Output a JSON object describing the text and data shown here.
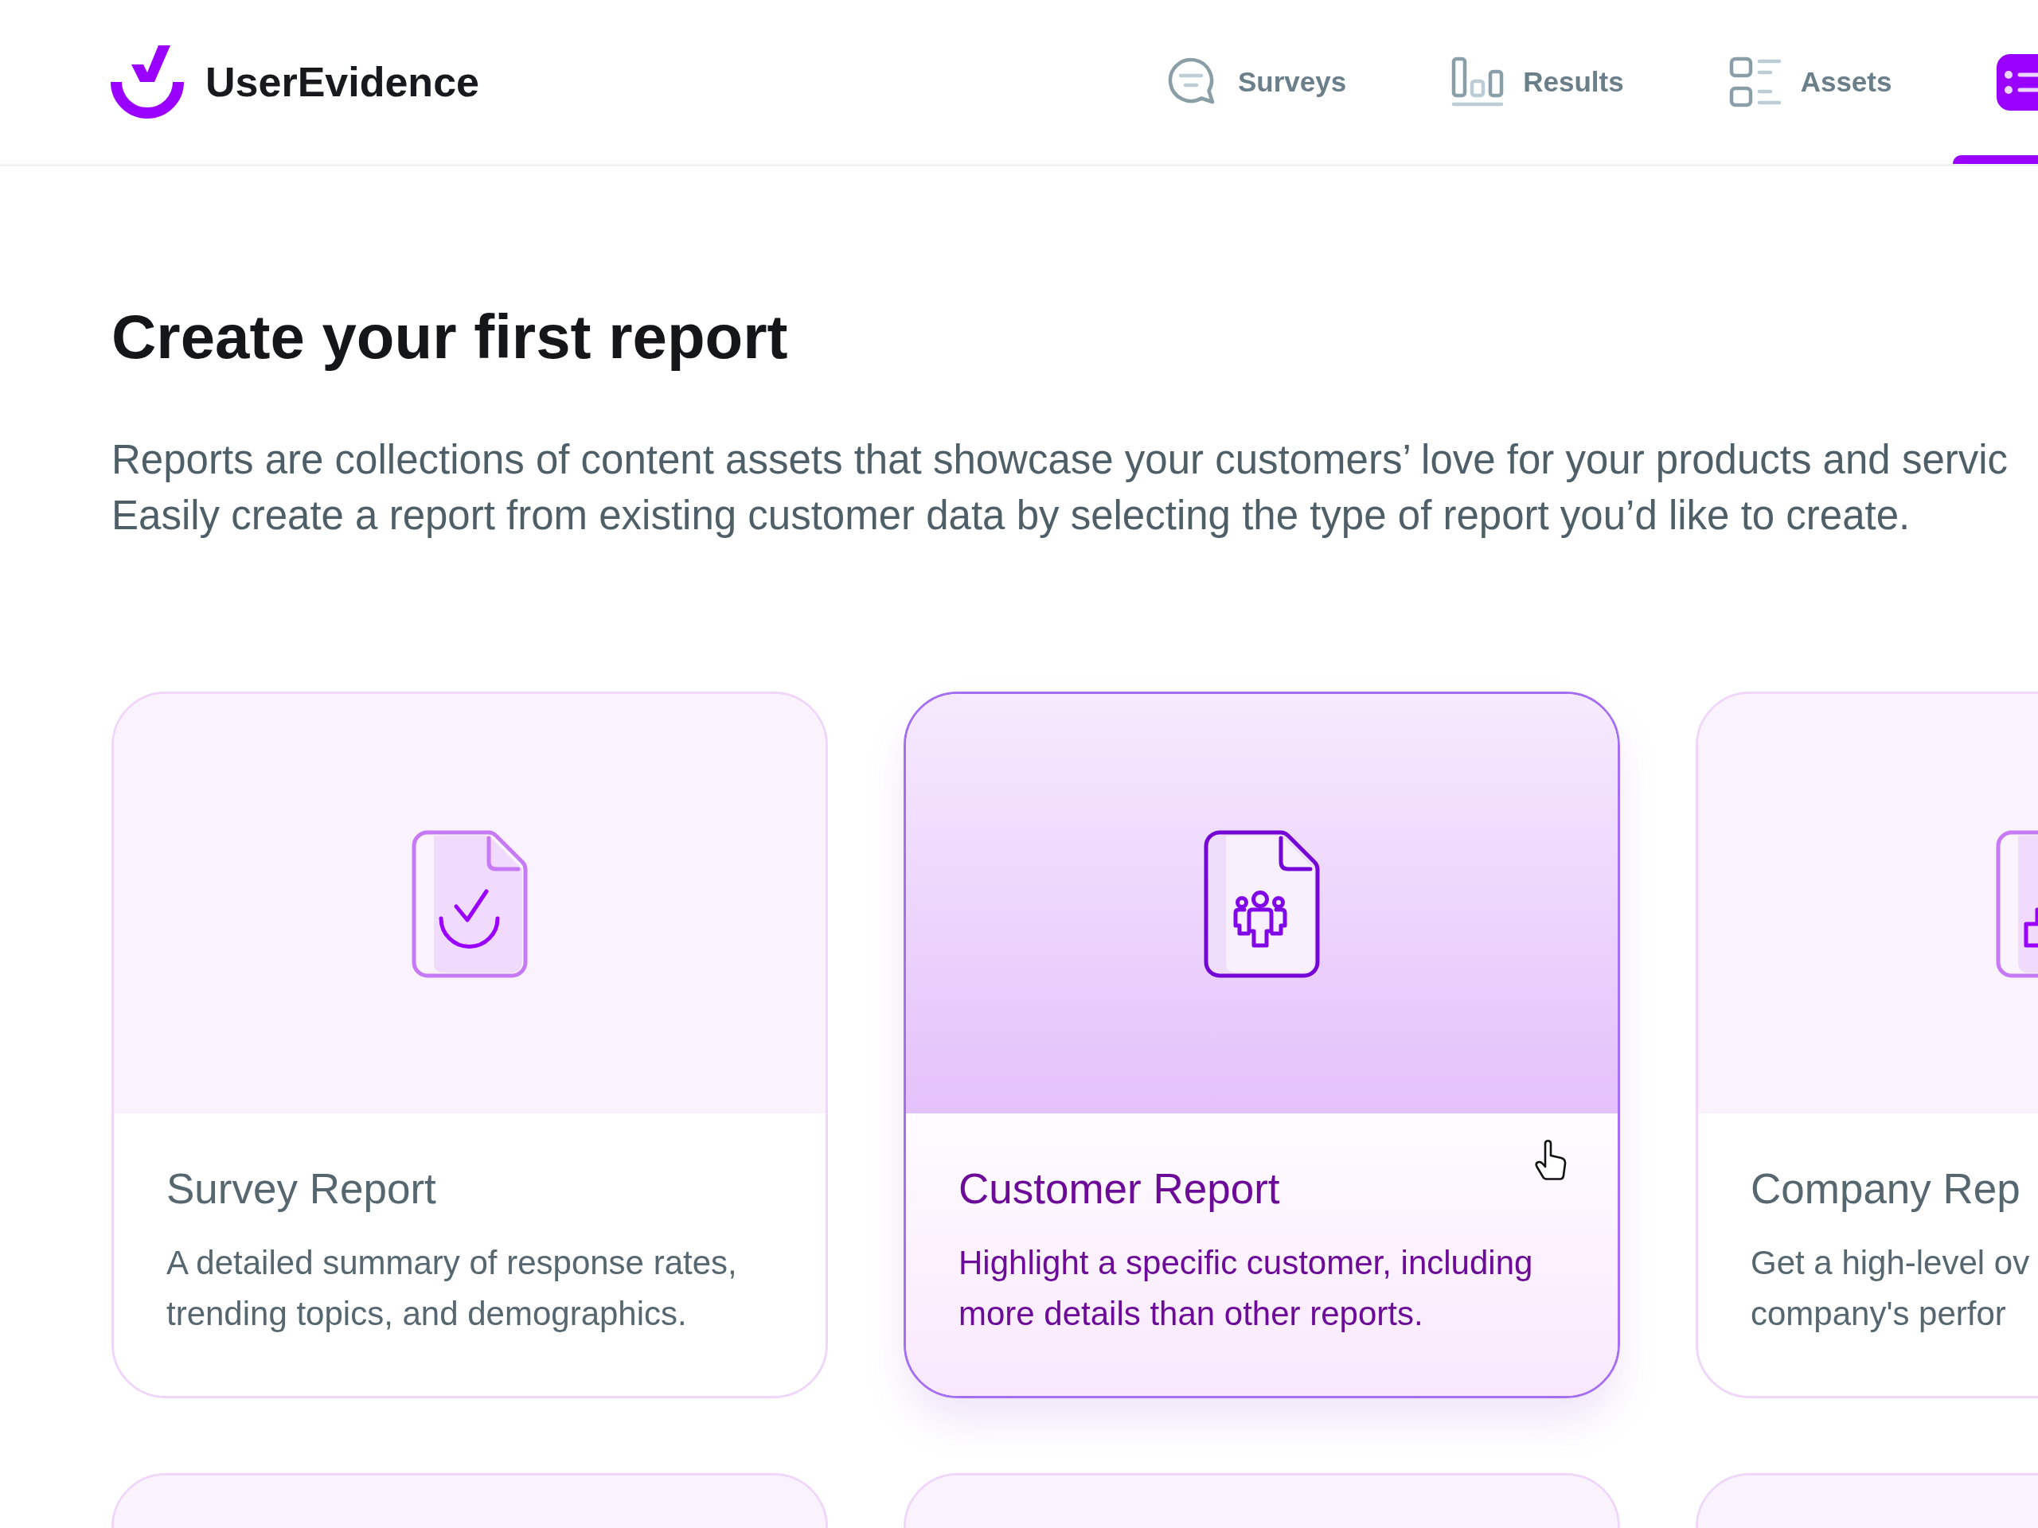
{
  "header": {
    "brand": "UserEvidence",
    "nav": [
      {
        "label": "Surveys",
        "selected": false
      },
      {
        "label": "Results",
        "selected": false
      },
      {
        "label": "Assets",
        "selected": false
      },
      {
        "selected": true
      }
    ]
  },
  "page": {
    "title": "Create your first report",
    "intro": [
      "Reports are collections of content assets that showcase your customers’ love for your products and servic",
      "Easily create a report from existing customer data by selecting the type of report you’d like to create."
    ]
  },
  "cards": [
    {
      "title": "Survey Report",
      "description": [
        "A detailed summary of response rates,",
        "trending topics, and demographics."
      ],
      "selected": false
    },
    {
      "title": "Customer Report",
      "description": [
        "Highlight a specific customer, including",
        "more details than other reports."
      ],
      "selected": true
    },
    {
      "title": "Company Rep",
      "description": [
        "Get a high-level ov",
        "company's perfor"
      ],
      "selected": false
    },
    {
      "selected": false
    },
    {
      "selected": false
    },
    {
      "selected": false
    }
  ]
}
